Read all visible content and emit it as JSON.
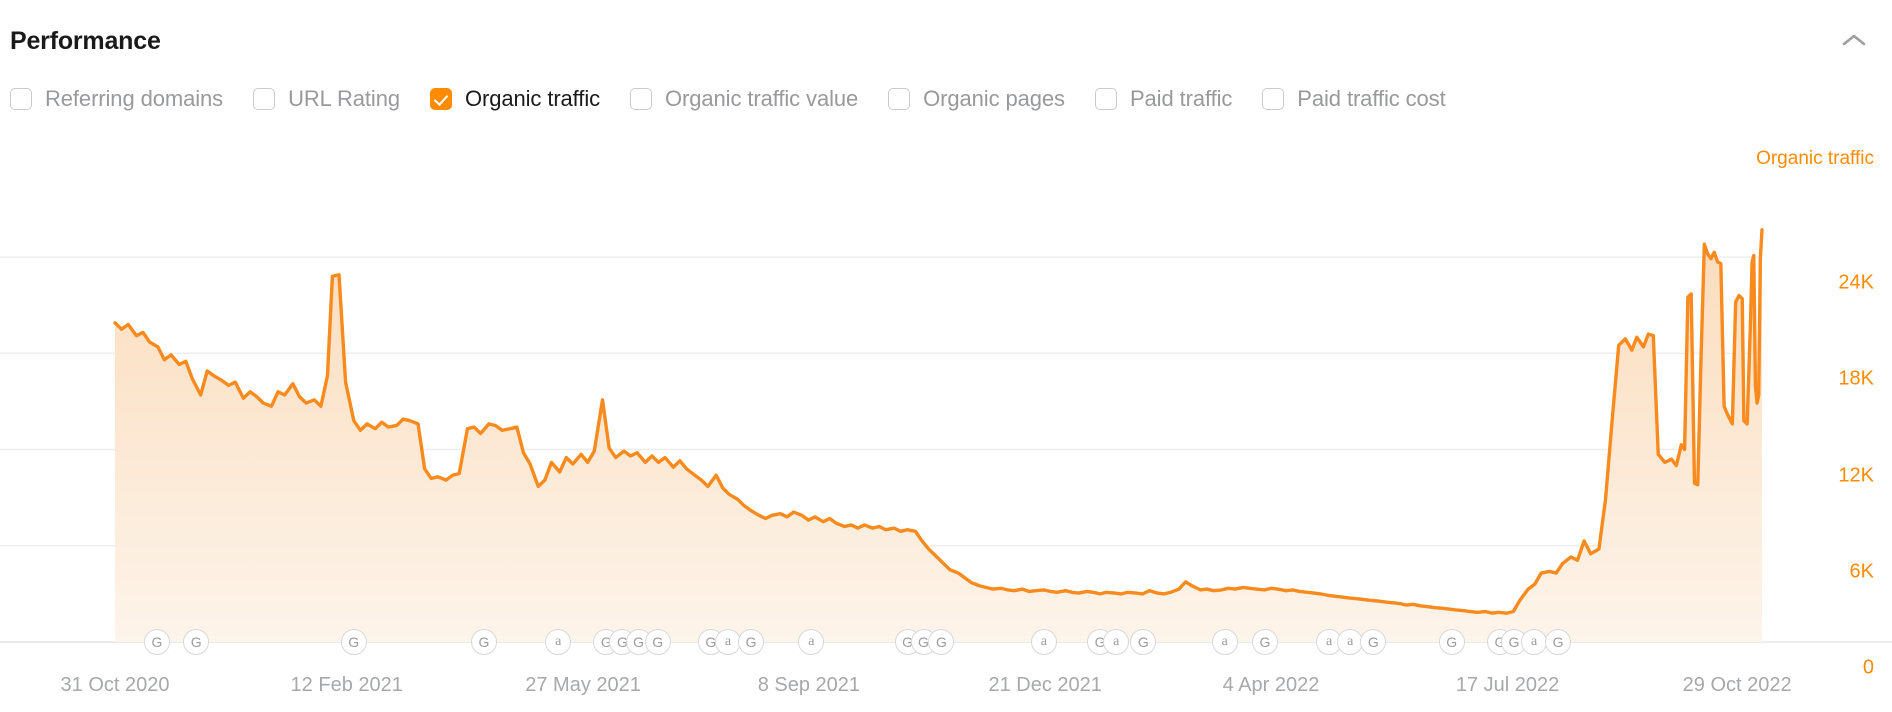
{
  "header": {
    "title": "Performance",
    "collapse_icon": "chevron-up-icon"
  },
  "legend": {
    "items": [
      {
        "label": "Referring domains",
        "checked": false
      },
      {
        "label": "URL Rating",
        "checked": false
      },
      {
        "label": "Organic traffic",
        "checked": true
      },
      {
        "label": "Organic traffic value",
        "checked": false
      },
      {
        "label": "Organic pages",
        "checked": false
      },
      {
        "label": "Paid traffic",
        "checked": false
      },
      {
        "label": "Paid traffic cost",
        "checked": false
      }
    ]
  },
  "colors": {
    "accent": "#ff8b00",
    "line": "#f98a1d",
    "area_top": "#fbdcbc",
    "area_bottom": "#fdf4ea",
    "grid": "#eeeeee",
    "axis_text": "#a6a8aa",
    "label_muted": "#98999b",
    "label_active": "#1a1a1a"
  },
  "chart_data": {
    "type": "area",
    "title": "Organic traffic",
    "series_label": "Organic traffic",
    "xlabel": "",
    "ylabel": "Organic traffic",
    "ylim": [
      0,
      30000
    ],
    "yticks": [
      24000,
      18000,
      12000,
      6000,
      0
    ],
    "ytick_labels": [
      "24K",
      "18K",
      "12K",
      "6K",
      "0"
    ],
    "grid": true,
    "legend_position": "top-right",
    "xtick_labels": [
      "31 Oct 2020",
      "12 Feb 2021",
      "27 May 2021",
      "8 Sep 2021",
      "21 Dec 2021",
      "4 Apr 2022",
      "17 Jul 2022",
      "29 Oct 2022"
    ],
    "xtick_fractions": [
      0.0,
      0.1407,
      0.2842,
      0.4213,
      0.5648,
      0.7019,
      0.8455,
      0.9849
    ],
    "x_start": "31 Oct 2020",
    "x_end": "29 Oct 2022",
    "points": [
      [
        0.0,
        19900
      ],
      [
        0.004,
        19500
      ],
      [
        0.008,
        19800
      ],
      [
        0.013,
        19100
      ],
      [
        0.017,
        19300
      ],
      [
        0.021,
        18700
      ],
      [
        0.026,
        18400
      ],
      [
        0.03,
        17600
      ],
      [
        0.034,
        17900
      ],
      [
        0.039,
        17300
      ],
      [
        0.043,
        17500
      ],
      [
        0.047,
        16400
      ],
      [
        0.052,
        15400
      ],
      [
        0.056,
        16900
      ],
      [
        0.06,
        16600
      ],
      [
        0.065,
        16300
      ],
      [
        0.069,
        16000
      ],
      [
        0.073,
        16200
      ],
      [
        0.078,
        15200
      ],
      [
        0.082,
        15600
      ],
      [
        0.086,
        15300
      ],
      [
        0.09,
        14900
      ],
      [
        0.095,
        14700
      ],
      [
        0.099,
        15600
      ],
      [
        0.103,
        15400
      ],
      [
        0.108,
        16100
      ],
      [
        0.112,
        15300
      ],
      [
        0.116,
        14900
      ],
      [
        0.121,
        15100
      ],
      [
        0.125,
        14700
      ],
      [
        0.129,
        16600
      ],
      [
        0.132,
        22800
      ],
      [
        0.136,
        22900
      ],
      [
        0.14,
        16200
      ],
      [
        0.145,
        13800
      ],
      [
        0.149,
        13200
      ],
      [
        0.153,
        13600
      ],
      [
        0.158,
        13300
      ],
      [
        0.162,
        13700
      ],
      [
        0.166,
        13400
      ],
      [
        0.171,
        13500
      ],
      [
        0.175,
        13900
      ],
      [
        0.179,
        13800
      ],
      [
        0.184,
        13600
      ],
      [
        0.188,
        10800
      ],
      [
        0.192,
        10200
      ],
      [
        0.196,
        10300
      ],
      [
        0.201,
        10100
      ],
      [
        0.205,
        10400
      ],
      [
        0.209,
        10500
      ],
      [
        0.214,
        13300
      ],
      [
        0.218,
        13400
      ],
      [
        0.222,
        13000
      ],
      [
        0.227,
        13600
      ],
      [
        0.231,
        13500
      ],
      [
        0.235,
        13200
      ],
      [
        0.24,
        13300
      ],
      [
        0.244,
        13400
      ],
      [
        0.248,
        11800
      ],
      [
        0.252,
        11100
      ],
      [
        0.257,
        9700
      ],
      [
        0.261,
        10100
      ],
      [
        0.265,
        11200
      ],
      [
        0.27,
        10600
      ],
      [
        0.274,
        11500
      ],
      [
        0.278,
        11100
      ],
      [
        0.283,
        11700
      ],
      [
        0.287,
        11200
      ],
      [
        0.291,
        11900
      ],
      [
        0.296,
        15100
      ],
      [
        0.3,
        12100
      ],
      [
        0.304,
        11500
      ],
      [
        0.309,
        11900
      ],
      [
        0.313,
        11600
      ],
      [
        0.317,
        11800
      ],
      [
        0.322,
        11200
      ],
      [
        0.326,
        11600
      ],
      [
        0.33,
        11200
      ],
      [
        0.334,
        11500
      ],
      [
        0.339,
        10900
      ],
      [
        0.343,
        11300
      ],
      [
        0.347,
        10800
      ],
      [
        0.352,
        10400
      ],
      [
        0.356,
        10100
      ],
      [
        0.36,
        9700
      ],
      [
        0.365,
        10400
      ],
      [
        0.369,
        9600
      ],
      [
        0.373,
        9200
      ],
      [
        0.378,
        8900
      ],
      [
        0.382,
        8500
      ],
      [
        0.386,
        8200
      ],
      [
        0.391,
        7900
      ],
      [
        0.395,
        7700
      ],
      [
        0.399,
        7900
      ],
      [
        0.404,
        8000
      ],
      [
        0.408,
        7800
      ],
      [
        0.412,
        8100
      ],
      [
        0.417,
        7900
      ],
      [
        0.421,
        7600
      ],
      [
        0.425,
        7800
      ],
      [
        0.43,
        7500
      ],
      [
        0.434,
        7700
      ],
      [
        0.438,
        7400
      ],
      [
        0.443,
        7200
      ],
      [
        0.447,
        7300
      ],
      [
        0.451,
        7100
      ],
      [
        0.455,
        7300
      ],
      [
        0.46,
        7100
      ],
      [
        0.464,
        7200
      ],
      [
        0.468,
        7000
      ],
      [
        0.473,
        7100
      ],
      [
        0.477,
        6900
      ],
      [
        0.481,
        7000
      ],
      [
        0.486,
        6900
      ],
      [
        0.49,
        6300
      ],
      [
        0.494,
        5800
      ],
      [
        0.499,
        5300
      ],
      [
        0.503,
        4900
      ],
      [
        0.507,
        4500
      ],
      [
        0.512,
        4300
      ],
      [
        0.516,
        4000
      ],
      [
        0.52,
        3700
      ],
      [
        0.525,
        3500
      ],
      [
        0.529,
        3400
      ],
      [
        0.533,
        3300
      ],
      [
        0.538,
        3350
      ],
      [
        0.542,
        3250
      ],
      [
        0.546,
        3200
      ],
      [
        0.551,
        3300
      ],
      [
        0.555,
        3150
      ],
      [
        0.559,
        3200
      ],
      [
        0.564,
        3250
      ],
      [
        0.568,
        3150
      ],
      [
        0.572,
        3100
      ],
      [
        0.577,
        3200
      ],
      [
        0.581,
        3100
      ],
      [
        0.585,
        3050
      ],
      [
        0.59,
        3150
      ],
      [
        0.594,
        3100
      ],
      [
        0.598,
        3000
      ],
      [
        0.602,
        3100
      ],
      [
        0.607,
        3050
      ],
      [
        0.611,
        3000
      ],
      [
        0.615,
        3100
      ],
      [
        0.62,
        3050
      ],
      [
        0.624,
        3000
      ],
      [
        0.628,
        3200
      ],
      [
        0.633,
        3050
      ],
      [
        0.637,
        3000
      ],
      [
        0.641,
        3100
      ],
      [
        0.646,
        3300
      ],
      [
        0.65,
        3750
      ],
      [
        0.654,
        3500
      ],
      [
        0.659,
        3250
      ],
      [
        0.663,
        3300
      ],
      [
        0.667,
        3200
      ],
      [
        0.672,
        3250
      ],
      [
        0.676,
        3350
      ],
      [
        0.68,
        3300
      ],
      [
        0.685,
        3400
      ],
      [
        0.689,
        3350
      ],
      [
        0.693,
        3300
      ],
      [
        0.698,
        3250
      ],
      [
        0.702,
        3350
      ],
      [
        0.706,
        3300
      ],
      [
        0.711,
        3200
      ],
      [
        0.715,
        3250
      ],
      [
        0.719,
        3150
      ],
      [
        0.724,
        3100
      ],
      [
        0.728,
        3050
      ],
      [
        0.732,
        3000
      ],
      [
        0.737,
        2900
      ],
      [
        0.741,
        2850
      ],
      [
        0.745,
        2800
      ],
      [
        0.749,
        2750
      ],
      [
        0.754,
        2700
      ],
      [
        0.758,
        2650
      ],
      [
        0.762,
        2600
      ],
      [
        0.767,
        2550
      ],
      [
        0.771,
        2500
      ],
      [
        0.775,
        2450
      ],
      [
        0.78,
        2400
      ],
      [
        0.784,
        2300
      ],
      [
        0.788,
        2350
      ],
      [
        0.793,
        2250
      ],
      [
        0.797,
        2200
      ],
      [
        0.801,
        2150
      ],
      [
        0.806,
        2100
      ],
      [
        0.81,
        2050
      ],
      [
        0.814,
        2000
      ],
      [
        0.819,
        1950
      ],
      [
        0.823,
        1900
      ],
      [
        0.827,
        1850
      ],
      [
        0.832,
        1900
      ],
      [
        0.836,
        1800
      ],
      [
        0.84,
        1850
      ],
      [
        0.845,
        1800
      ],
      [
        0.849,
        1900
      ],
      [
        0.853,
        2600
      ],
      [
        0.858,
        3300
      ],
      [
        0.862,
        3600
      ],
      [
        0.866,
        4300
      ],
      [
        0.871,
        4400
      ],
      [
        0.875,
        4300
      ],
      [
        0.879,
        4900
      ],
      [
        0.884,
        5300
      ],
      [
        0.888,
        5100
      ],
      [
        0.892,
        6300
      ],
      [
        0.896,
        5500
      ],
      [
        0.901,
        5800
      ],
      [
        0.905,
        8900
      ],
      [
        0.909,
        13800
      ],
      [
        0.913,
        18500
      ],
      [
        0.917,
        18900
      ],
      [
        0.921,
        18200
      ],
      [
        0.924,
        19000
      ],
      [
        0.928,
        18400
      ],
      [
        0.931,
        19200
      ],
      [
        0.934,
        19100
      ],
      [
        0.937,
        11700
      ],
      [
        0.941,
        11200
      ],
      [
        0.945,
        11400
      ],
      [
        0.948,
        11000
      ],
      [
        0.951,
        12300
      ],
      [
        0.953,
        12000
      ],
      [
        0.955,
        21500
      ],
      [
        0.957,
        21700
      ],
      [
        0.959,
        9900
      ],
      [
        0.961,
        9800
      ],
      [
        0.963,
        17800
      ],
      [
        0.965,
        24800
      ],
      [
        0.967,
        24200
      ],
      [
        0.969,
        23900
      ],
      [
        0.971,
        24300
      ],
      [
        0.973,
        23700
      ],
      [
        0.975,
        23600
      ],
      [
        0.977,
        14700
      ],
      [
        0.979,
        14200
      ],
      [
        0.98,
        14000
      ],
      [
        0.982,
        13600
      ],
      [
        0.984,
        21200
      ],
      [
        0.986,
        21600
      ],
      [
        0.988,
        21400
      ],
      [
        0.989,
        13800
      ],
      [
        0.991,
        13600
      ],
      [
        0.993,
        19900
      ],
      [
        0.994,
        23700
      ],
      [
        0.995,
        24100
      ],
      [
        0.996,
        16000
      ],
      [
        0.997,
        14900
      ],
      [
        0.998,
        15400
      ],
      [
        0.999,
        23900
      ],
      [
        1.0,
        25700
      ]
    ],
    "markers": [
      {
        "x": 0.0255,
        "type": "G"
      },
      {
        "x": 0.0493,
        "type": "G"
      },
      {
        "x": 0.1449,
        "type": "G"
      },
      {
        "x": 0.224,
        "type": "G"
      },
      {
        "x": 0.2691,
        "type": "a"
      },
      {
        "x": 0.2983,
        "type": "G"
      },
      {
        "x": 0.3081,
        "type": "G"
      },
      {
        "x": 0.3179,
        "type": "G"
      },
      {
        "x": 0.3295,
        "type": "G"
      },
      {
        "x": 0.3618,
        "type": "G"
      },
      {
        "x": 0.3722,
        "type": "a"
      },
      {
        "x": 0.3862,
        "type": "G"
      },
      {
        "x": 0.4228,
        "type": "a"
      },
      {
        "x": 0.4812,
        "type": "G"
      },
      {
        "x": 0.4909,
        "type": "G"
      },
      {
        "x": 0.5018,
        "type": "G"
      },
      {
        "x": 0.564,
        "type": "a"
      },
      {
        "x": 0.5981,
        "type": "G"
      },
      {
        "x": 0.6079,
        "type": "a"
      },
      {
        "x": 0.6244,
        "type": "G"
      },
      {
        "x": 0.6738,
        "type": "a"
      },
      {
        "x": 0.6982,
        "type": "G"
      },
      {
        "x": 0.7372,
        "type": "a"
      },
      {
        "x": 0.75,
        "type": "a"
      },
      {
        "x": 0.764,
        "type": "G"
      },
      {
        "x": 0.8116,
        "type": "G"
      },
      {
        "x": 0.8409,
        "type": "G"
      },
      {
        "x": 0.8494,
        "type": "G"
      },
      {
        "x": 0.8616,
        "type": "a"
      },
      {
        "x": 0.8762,
        "type": "G"
      }
    ]
  }
}
